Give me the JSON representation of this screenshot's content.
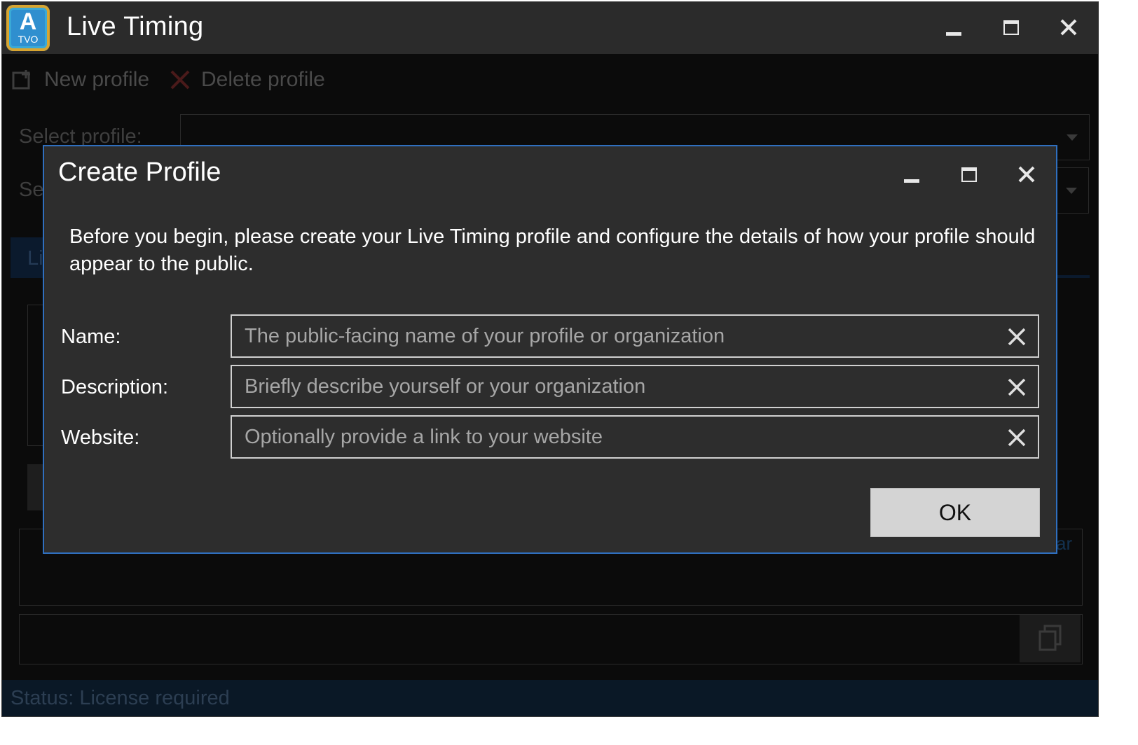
{
  "app": {
    "logo_letter": "A",
    "logo_subtext": "TVO",
    "title": "Live Timing"
  },
  "toolbar": {
    "new_profile_label": "New profile",
    "delete_profile_label": "Delete profile"
  },
  "background": {
    "select_profile_label": "Select profile:",
    "second_select_label": "Se",
    "tab_partial_label": "Li",
    "link_partial": "ar"
  },
  "status": {
    "text": "Status: License required"
  },
  "dialog": {
    "title": "Create Profile",
    "intro": "Before you begin, please create your Live Timing profile and configure the details of how your profile should appear to the public.",
    "fields": [
      {
        "label": "Name:",
        "value": "",
        "placeholder": "The public-facing name of your profile or organization"
      },
      {
        "label": "Description:",
        "value": "",
        "placeholder": "Briefly describe yourself or your organization"
      },
      {
        "label": "Website:",
        "value": "",
        "placeholder": "Optionally provide a link to your website"
      }
    ],
    "ok_label": "OK"
  },
  "colors": {
    "dialog_border": "#2f6fbf",
    "dialog_bg": "#2d2d2d",
    "titlebar_bg": "#2b2b2b",
    "status_bg": "#0a1826",
    "ok_button_bg": "#d4d4d4"
  },
  "icons": {
    "app_logo": "app-logo-icon",
    "new_profile": "add-profile-icon",
    "delete_profile": "delete-x-icon",
    "copy": "copy-icon",
    "clear_field": "clear-x-icon"
  }
}
